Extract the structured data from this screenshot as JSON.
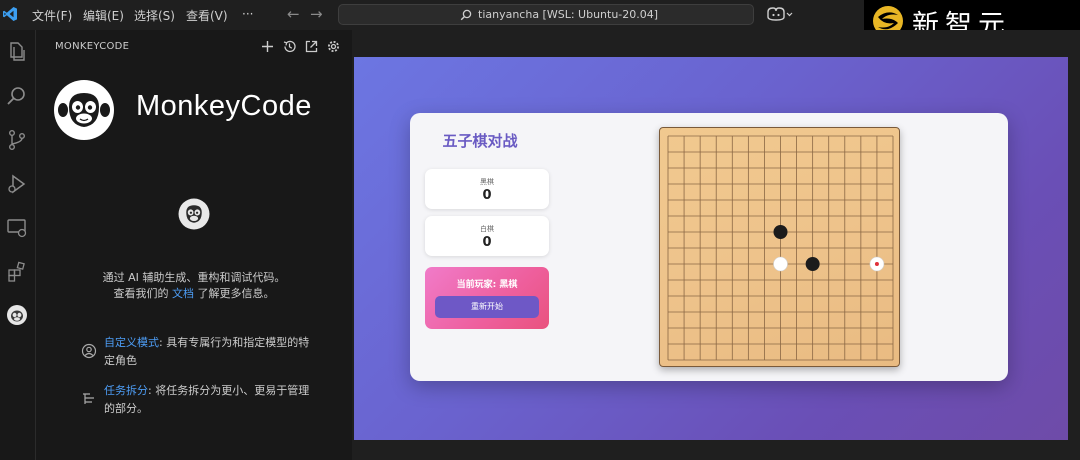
{
  "titlebar": {
    "menu": [
      "文件(F)",
      "编辑(E)",
      "选择(S)",
      "查看(V)",
      "···"
    ],
    "search_text": "tianyancha [WSL: Ubuntu-20.04]"
  },
  "watermark": {
    "text": "新智元"
  },
  "sidebar": {
    "title": "MONKEYCODE",
    "brand": "MonkeyCode",
    "intro_line1": "通过 AI 辅助生成、重构和调试代码。",
    "intro_line2_a": "查看我们的 ",
    "intro_line2_link": "文档",
    "intro_line2_b": " 了解更多信息。",
    "features": [
      {
        "title": "自定义模式",
        "desc": ": 具有专属行为和指定模型的特定角色"
      },
      {
        "title": "任务拆分",
        "desc": ": 将任务拆分为更小、更易于管理的部分。"
      }
    ]
  },
  "game": {
    "title": "五子棋对战",
    "black_label": "黑棋",
    "black_score": "0",
    "white_label": "白棋",
    "white_score": "0",
    "current_player": "当前玩家: 黑棋",
    "restart_label": "重新开始",
    "board": {
      "size": 15,
      "stones": [
        {
          "col": 7,
          "row": 6,
          "color": "black"
        },
        {
          "col": 7,
          "row": 8,
          "color": "white"
        },
        {
          "col": 9,
          "row": 8,
          "color": "black"
        },
        {
          "col": 13,
          "row": 8,
          "color": "white",
          "last_move": true
        }
      ]
    }
  },
  "colors": {
    "link": "#4d9df5",
    "accent_purple": "#6a5bc3",
    "panel_pink": "#ee5f9d",
    "board_wood": "#eec38b"
  }
}
